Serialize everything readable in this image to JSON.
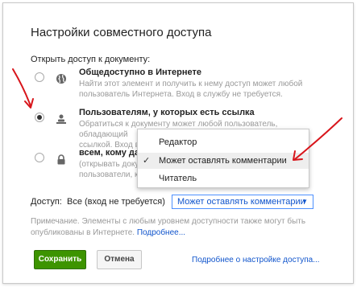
{
  "dialog": {
    "title": "Настройки совместного доступа",
    "section_label": "Открыть доступ к документу:"
  },
  "options": [
    {
      "title": "Общедоступно в Интернете",
      "desc_line1": "Найти этот элемент и получить к нему доступ может любой",
      "desc_line2": "пользователь Интернета. Вход в службу не требуется.",
      "icon": "globe-icon",
      "checked": false
    },
    {
      "title": "Пользователям, у которых есть ссылка",
      "desc_line1": "Обратиться к документу может любой пользователь, обладающий",
      "desc_line2": "ссылкой. Вход в с",
      "icon": "people-icon",
      "checked": true
    },
    {
      "title": "всем, кому дан",
      "desc_line1": "(открывать доку",
      "desc_line2": "пользователи, ко",
      "icon": "lock-icon",
      "checked": false
    }
  ],
  "access": {
    "label": "Доступ:",
    "value": "Все (вход не требуется)",
    "dropdown_value": "Может оставлять комментарии"
  },
  "menu": {
    "items": [
      {
        "label": "Редактор",
        "selected": false
      },
      {
        "label": "Может оставлять комментарии",
        "selected": true
      },
      {
        "label": "Читатель",
        "selected": false
      }
    ]
  },
  "note": {
    "text_line1": "Примечание. Элементы с любым уровнем доступности также могут быть",
    "text_line2": "опубликованы в Интернете.",
    "link": "Подробнее..."
  },
  "buttons": {
    "save": "Сохранить",
    "cancel": "Отмена",
    "more_link": "Подробнее о настройке доступа..."
  },
  "colors": {
    "link_blue": "#1155cc",
    "save_green": "#3d9400",
    "annotation_red": "#d8151b"
  }
}
